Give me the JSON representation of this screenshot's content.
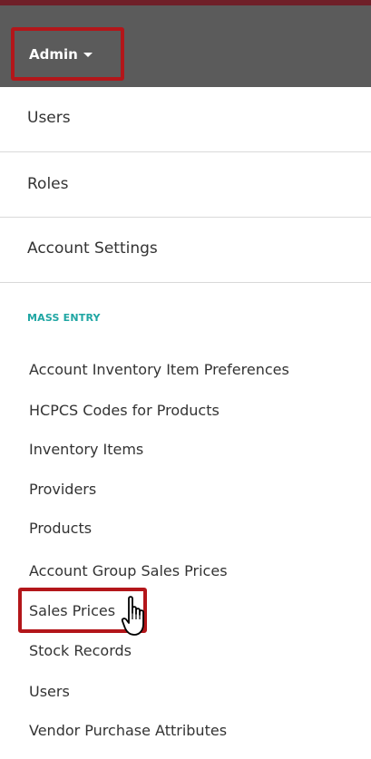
{
  "navbar": {
    "admin_label": "Admin",
    "accent_color": "#b3161a",
    "background_color": "#5b5b5b"
  },
  "menu": {
    "items": [
      {
        "label": "Users"
      },
      {
        "label": "Roles"
      },
      {
        "label": "Account Settings"
      }
    ]
  },
  "mass_entry": {
    "header": "MASS ENTRY",
    "header_color": "#1fa6a3",
    "items": [
      {
        "label": "Account Inventory Item Preferences"
      },
      {
        "label": "HCPCS Codes for Products"
      },
      {
        "label": "Inventory Items"
      },
      {
        "label": "Providers"
      },
      {
        "label": "Products"
      },
      {
        "label": "Account Group Sales Prices"
      },
      {
        "label": "Sales Prices"
      },
      {
        "label": "Stock Records"
      },
      {
        "label": "Users"
      },
      {
        "label": "Vendor Purchase Attributes"
      }
    ]
  },
  "cursor": {
    "icon": "hand-pointer-icon"
  }
}
